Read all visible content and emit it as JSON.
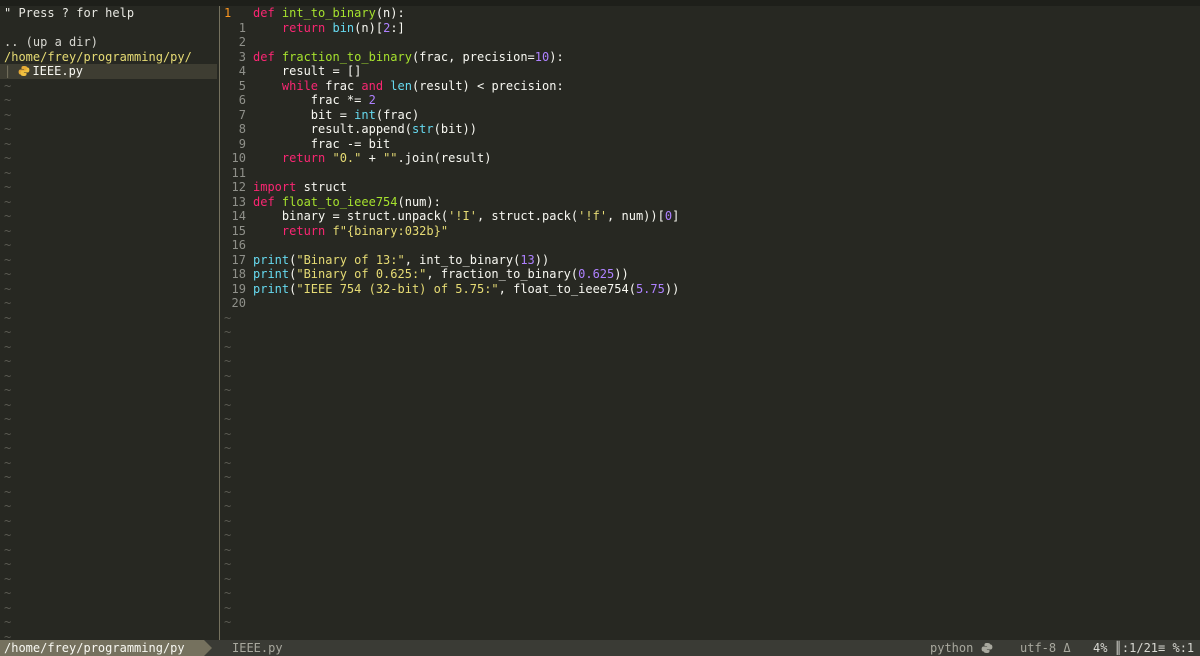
{
  "tree": {
    "help": "\" Press ? for help",
    "updir": ".. (up a dir)",
    "path": "/home/frey/programming/py/",
    "file": "IEEE.py",
    "tilde": "~"
  },
  "editor": {
    "current_line_number": "1",
    "lines": [
      {
        "n": "1",
        "t": [
          [
            "kw",
            "def "
          ],
          [
            "fn",
            "int_to_binary"
          ],
          [
            "",
            "(n):"
          ]
        ]
      },
      {
        "n": "1",
        "t": [
          [
            "",
            "    "
          ],
          [
            "kw",
            "return "
          ],
          [
            "bi",
            "bin"
          ],
          [
            "",
            "(n)["
          ],
          [
            "num",
            "2"
          ],
          [
            "",
            ":]"
          ]
        ]
      },
      {
        "n": "2",
        "t": []
      },
      {
        "n": "3",
        "t": [
          [
            "kw",
            "def "
          ],
          [
            "fn",
            "fraction_to_binary"
          ],
          [
            "",
            "(frac, precision="
          ],
          [
            "num",
            "10"
          ],
          [
            "",
            "):"
          ]
        ]
      },
      {
        "n": "4",
        "t": [
          [
            "",
            "    result = []"
          ]
        ]
      },
      {
        "n": "5",
        "t": [
          [
            "",
            "    "
          ],
          [
            "kw",
            "while "
          ],
          [
            "",
            "frac "
          ],
          [
            "kw",
            "and "
          ],
          [
            "bi",
            "len"
          ],
          [
            "",
            "(result) < precision:"
          ]
        ]
      },
      {
        "n": "6",
        "t": [
          [
            "",
            "        frac *= "
          ],
          [
            "num",
            "2"
          ]
        ]
      },
      {
        "n": "7",
        "t": [
          [
            "",
            "        bit = "
          ],
          [
            "bi",
            "int"
          ],
          [
            "",
            "(frac)"
          ]
        ]
      },
      {
        "n": "8",
        "t": [
          [
            "",
            "        result.append("
          ],
          [
            "bi",
            "str"
          ],
          [
            "",
            "(bit))"
          ]
        ]
      },
      {
        "n": "9",
        "t": [
          [
            "",
            "        frac -= bit"
          ]
        ]
      },
      {
        "n": "10",
        "t": [
          [
            "",
            "    "
          ],
          [
            "kw",
            "return "
          ],
          [
            "str",
            "\"0.\""
          ],
          [
            "",
            " + "
          ],
          [
            "str",
            "\"\""
          ],
          [
            "",
            ".join(result)"
          ]
        ]
      },
      {
        "n": "11",
        "t": []
      },
      {
        "n": "12",
        "t": [
          [
            "kw",
            "import "
          ],
          [
            "",
            "struct"
          ]
        ]
      },
      {
        "n": "13",
        "t": [
          [
            "kw",
            "def "
          ],
          [
            "fn",
            "float_to_ieee754"
          ],
          [
            "",
            "(num):"
          ]
        ]
      },
      {
        "n": "14",
        "t": [
          [
            "",
            "    binary = struct.unpack("
          ],
          [
            "str",
            "'!I'"
          ],
          [
            "",
            ", struct.pack("
          ],
          [
            "str",
            "'!f'"
          ],
          [
            "",
            ", num))["
          ],
          [
            "num",
            "0"
          ],
          [
            "",
            "]"
          ]
        ]
      },
      {
        "n": "15",
        "t": [
          [
            "",
            "    "
          ],
          [
            "kw",
            "return "
          ],
          [
            "str",
            "f\"{binary:032b}\""
          ]
        ]
      },
      {
        "n": "16",
        "t": []
      },
      {
        "n": "17",
        "t": [
          [
            "bi",
            "print"
          ],
          [
            "",
            "("
          ],
          [
            "str",
            "\"Binary of 13:\""
          ],
          [
            "",
            ", int_to_binary("
          ],
          [
            "num",
            "13"
          ],
          [
            "",
            "))"
          ]
        ]
      },
      {
        "n": "18",
        "t": [
          [
            "bi",
            "print"
          ],
          [
            "",
            "("
          ],
          [
            "str",
            "\"Binary of 0.625:\""
          ],
          [
            "",
            ", fraction_to_binary("
          ],
          [
            "num",
            "0.625"
          ],
          [
            "",
            "))"
          ]
        ]
      },
      {
        "n": "19",
        "t": [
          [
            "bi",
            "print"
          ],
          [
            "",
            "("
          ],
          [
            "str",
            "\"IEEE 754 (32-bit) of 5.75:\""
          ],
          [
            "",
            ", float_to_ieee754("
          ],
          [
            "num",
            "5.75"
          ],
          [
            "",
            "))"
          ]
        ]
      },
      {
        "n": "20",
        "t": []
      }
    ],
    "tilde": "~"
  },
  "status": {
    "cwd": "/home/frey/programming/py",
    "filename": "IEEE.py",
    "filetype": "python",
    "encoding": "utf-8 Δ",
    "position": "4% ║:1/21≡ %:1"
  },
  "colors": {
    "background": "#272822",
    "keyword": "#f92672",
    "function": "#a6e22e",
    "builtin": "#66d9ef",
    "string": "#e6db74",
    "number": "#ae81ff",
    "current_line_number": "#fd971f"
  },
  "icons": {
    "python_file": "python-logo-icon"
  }
}
